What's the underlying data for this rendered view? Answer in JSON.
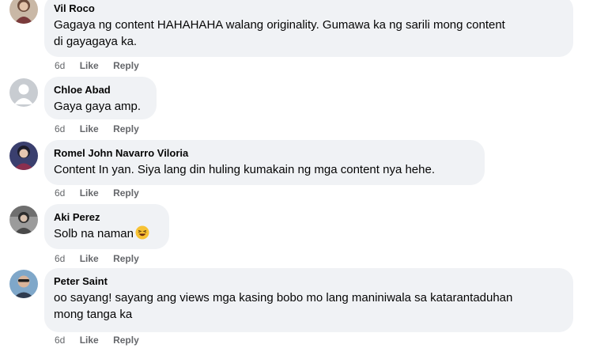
{
  "comments": [
    {
      "author": "Vil Roco",
      "text": "Gagaya ng content HAHAHAHA walang originality. Gumawa ka ng sarili mong content\ndi gayagaya ka.",
      "time": "6d",
      "like_label": "Like",
      "reply_label": "Reply",
      "avatar_icon": "profile-photo"
    },
    {
      "author": "Chloe Abad",
      "text": "Gaya gaya amp.",
      "time": "6d",
      "like_label": "Like",
      "reply_label": "Reply",
      "avatar_icon": "default-avatar"
    },
    {
      "author": "Romel John Navarro Viloria",
      "text": "Content In yan. Siya lang din huling kumakain ng mga content nya hehe.",
      "time": "6d",
      "like_label": "Like",
      "reply_label": "Reply",
      "avatar_icon": "profile-photo"
    },
    {
      "author": "Aki Perez",
      "text": "Solb na naman",
      "emoji": "laughing-emoji",
      "time": "6d",
      "like_label": "Like",
      "reply_label": "Reply",
      "avatar_icon": "profile-photo"
    },
    {
      "author": "Peter Saint",
      "text": "oo sayang! sayang ang views mga kasing bobo mo lang maniniwala sa katarantaduhan\nmong tanga ka",
      "time": "6d",
      "like_label": "Like",
      "reply_label": "Reply",
      "avatar_icon": "profile-photo"
    }
  ],
  "colors": {
    "bubble_bg": "#f0f2f5",
    "text": "#050505",
    "secondary_text": "#65676b"
  }
}
